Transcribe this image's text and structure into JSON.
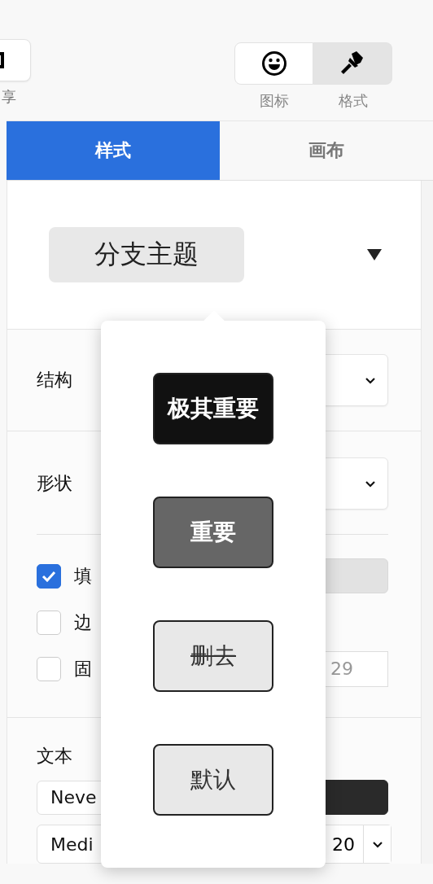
{
  "toolbar": {
    "left_label": "享",
    "view_switch": [
      {
        "label": "图标",
        "kind": "smiley",
        "selected": false
      },
      {
        "label": "格式",
        "kind": "brush",
        "selected": true
      }
    ]
  },
  "tabs": [
    {
      "label": "样式",
      "selected": true
    },
    {
      "label": "画布",
      "selected": false
    }
  ],
  "theme": {
    "label": "分支主题"
  },
  "structure": {
    "label": "结构"
  },
  "shape": {
    "label": "形状"
  },
  "options": [
    {
      "label": "填",
      "checked": true,
      "kind": "swatch"
    },
    {
      "label": "边",
      "checked": false,
      "kind": "none"
    },
    {
      "label": "固",
      "checked": false,
      "kind": "number",
      "value": "29"
    }
  ],
  "text": {
    "label": "文本",
    "font": "Neve",
    "weight": "Medi",
    "size": "20"
  },
  "markers": [
    {
      "label": "极其重要",
      "kind": "critical"
    },
    {
      "label": "重要",
      "kind": "important"
    },
    {
      "label": "删去",
      "kind": "deleted"
    },
    {
      "label": "默认",
      "kind": "default"
    }
  ]
}
